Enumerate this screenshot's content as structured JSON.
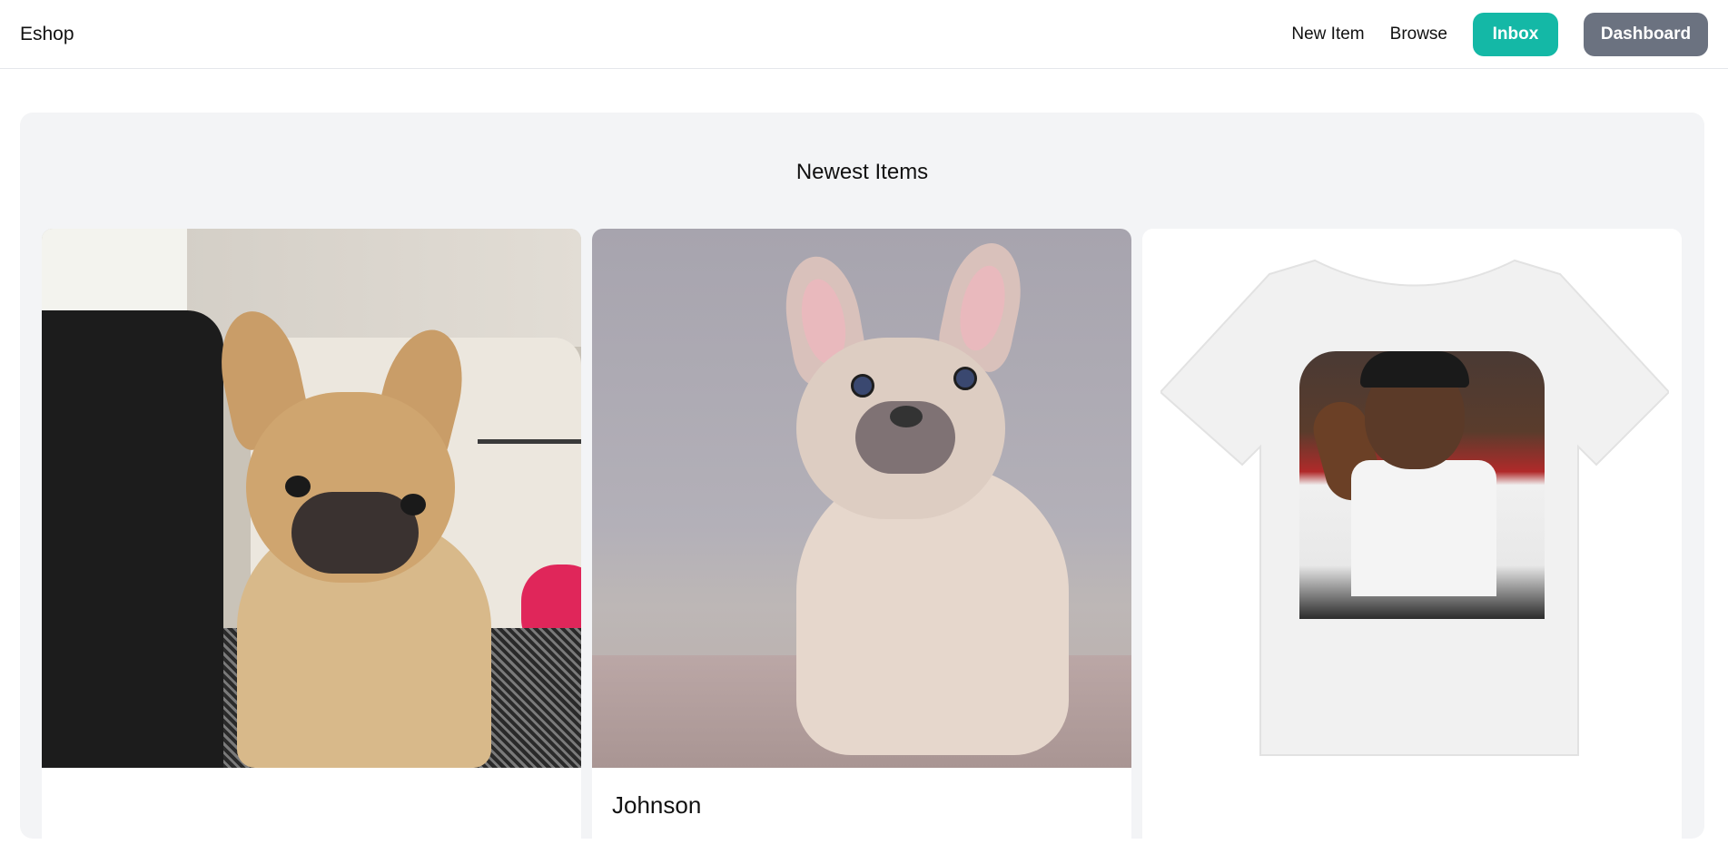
{
  "navbar": {
    "brand": "Eshop",
    "links": [
      "New Item",
      "Browse"
    ],
    "inbox_label": "Inbox",
    "dashboard_label": "Dashboard",
    "colors": {
      "inbox": "#14b8a6",
      "dashboard": "#6b7280"
    }
  },
  "main": {
    "title": "Newest Items",
    "items": [
      {
        "name": "",
        "image": "fawn-french-bulldog-photo"
      },
      {
        "name": "Johnson",
        "image": "cream-french-bulldog-puppy-photo"
      },
      {
        "name": "",
        "image": "white-tshirt-bulls-23-print-photo"
      }
    ]
  }
}
